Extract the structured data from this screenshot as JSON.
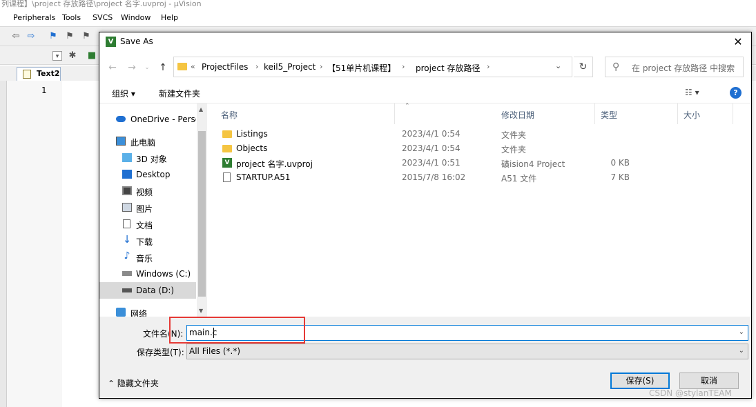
{
  "ide": {
    "title": "列课程】\\project 存放路径\\project 名字.uvproj - µVision",
    "menu": [
      "Peripherals",
      "Tools",
      "SVCS",
      "Window",
      "Help"
    ],
    "tab_label": "Text2",
    "line_number": "1"
  },
  "dialog": {
    "title": "Save As",
    "close_icon": "close-icon",
    "breadcrumb": {
      "overflow": "«",
      "items": [
        "ProjectFiles",
        "keil5_Project",
        "【51单片机课程】",
        "project 存放路径"
      ]
    },
    "search_placeholder": "在 project 存放路径 中搜索",
    "toolbar": {
      "organize": "组织 ▾",
      "new_folder": "新建文件夹"
    },
    "help_label": "?",
    "nav_items": [
      {
        "label": "OneDrive - Persona",
        "icon": "cloud-icon"
      },
      {
        "label": "此电脑",
        "icon": "computer-icon"
      },
      {
        "label": "3D 对象",
        "icon": "3d-objects-icon"
      },
      {
        "label": "Desktop",
        "icon": "desktop-icon"
      },
      {
        "label": "视频",
        "icon": "video-icon"
      },
      {
        "label": "图片",
        "icon": "picture-icon"
      },
      {
        "label": "文档",
        "icon": "document-icon"
      },
      {
        "label": "下载",
        "icon": "download-icon"
      },
      {
        "label": "音乐",
        "icon": "music-icon"
      },
      {
        "label": "Windows (C:)",
        "icon": "drive-icon"
      },
      {
        "label": "Data (D:)",
        "icon": "drive-icon"
      },
      {
        "label": "网络",
        "icon": "network-icon"
      }
    ],
    "columns": [
      "名称",
      "修改日期",
      "类型",
      "大小"
    ],
    "files": [
      {
        "name": "Listings",
        "date": "2023/4/1 0:54",
        "type": "文件夹",
        "size": "",
        "icon": "folder-icon"
      },
      {
        "name": "Objects",
        "date": "2023/4/1 0:54",
        "type": "文件夹",
        "size": "",
        "icon": "folder-icon"
      },
      {
        "name": "project 名字.uvproj",
        "date": "2023/4/1 0:51",
        "type": "礦ision4 Project",
        "size": "0 KB",
        "icon": "uvproj-icon"
      },
      {
        "name": "STARTUP.A51",
        "date": "2015/7/8 16:02",
        "type": "A51 文件",
        "size": "7 KB",
        "icon": "file-icon"
      }
    ],
    "filename_label": "文件名(N):",
    "filename_value": "main.c",
    "filetype_label": "保存类型(T):",
    "filetype_value": "All Files (*.*)",
    "hide_folders": "隐藏文件夹",
    "save_button": "保存(S)",
    "cancel_button": "取消"
  },
  "watermark": "CSDN @stylanTEAM",
  "colors": {
    "accent": "#0078d7",
    "highlight": "#e53935",
    "folder": "#f5c542"
  }
}
